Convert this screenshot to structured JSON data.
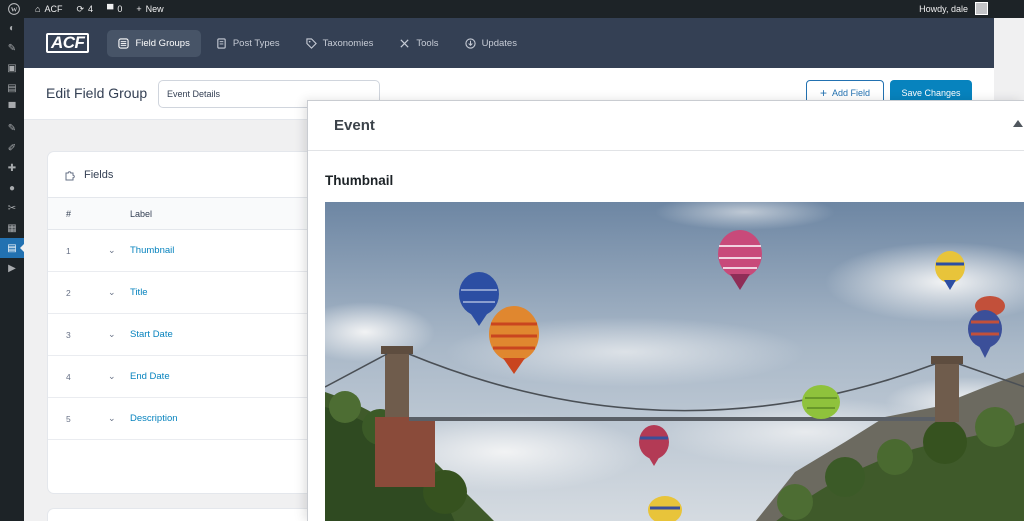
{
  "adminbar": {
    "site_name": "ACF",
    "updates_count": "4",
    "comments_count": "0",
    "new_label": "New",
    "howdy": "Howdy, dale"
  },
  "acf_nav": {
    "logo": "ACF",
    "tabs": [
      {
        "label": "Field Groups",
        "icon": "field-groups-icon",
        "active": true
      },
      {
        "label": "Post Types",
        "icon": "post-types-icon"
      },
      {
        "label": "Taxonomies",
        "icon": "taxonomies-icon"
      },
      {
        "label": "Tools",
        "icon": "tools-icon"
      },
      {
        "label": "Updates",
        "icon": "updates-icon"
      }
    ]
  },
  "edit": {
    "title": "Edit Field Group",
    "group_name": "Event Details",
    "add_field_label": "Add Field",
    "save_label": "Save Changes"
  },
  "fields": {
    "heading": "Fields",
    "col_num": "#",
    "col_label": "Label",
    "rows": [
      {
        "num": "1",
        "label": "Thumbnail"
      },
      {
        "num": "2",
        "label": "Title"
      },
      {
        "num": "3",
        "label": "Start Date"
      },
      {
        "num": "4",
        "label": "End Date"
      },
      {
        "num": "5",
        "label": "Description"
      }
    ]
  },
  "preview": {
    "title": "Event",
    "field_label": "Thumbnail"
  },
  "colors": {
    "admin_dark": "#1d2327",
    "acf_header": "#344054",
    "link_blue": "#0783be",
    "wp_blue": "#2271b1"
  }
}
